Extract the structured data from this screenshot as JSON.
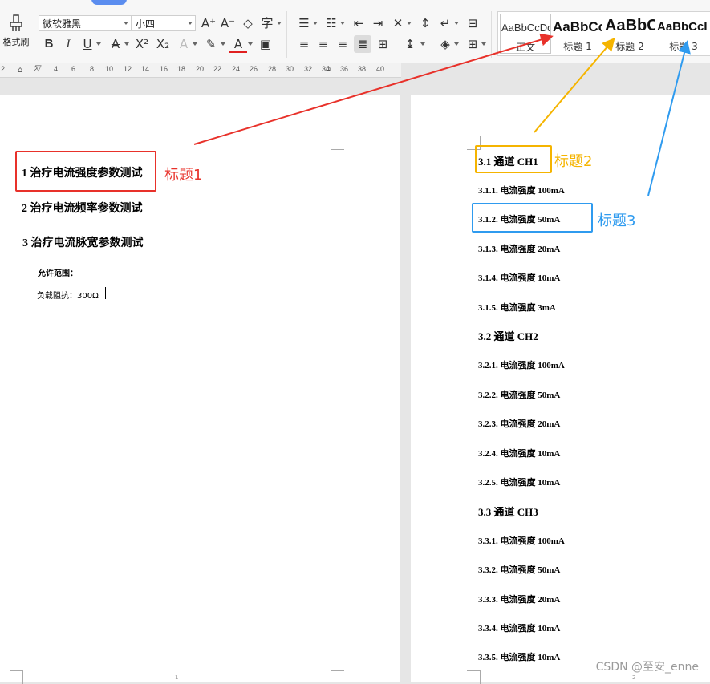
{
  "ribbon": {
    "format_painter_label": "格式刷",
    "font_name": "微软雅黑",
    "font_size": "小四",
    "styles": [
      {
        "sample": "AaBbCcDd",
        "name": "正文"
      },
      {
        "sample": "AaBbCcI",
        "name": "标题 1"
      },
      {
        "sample": "AaBbC",
        "name": "标题 2"
      },
      {
        "sample": "AaBbCcI",
        "name": "标题 3"
      }
    ]
  },
  "ruler": {
    "ticks": [
      "2",
      "2",
      "4",
      "6",
      "8",
      "10",
      "12",
      "14",
      "16",
      "18",
      "20",
      "22",
      "24",
      "26",
      "28",
      "30",
      "32",
      "34",
      "36",
      "38",
      "40"
    ]
  },
  "left_page": {
    "headings": [
      "1 治疗电流强度参数测试",
      "2 治疗电流频率参数测试",
      "3  治疗电流脉宽参数测试"
    ],
    "allowed_range_label": "允许范围：",
    "load_impedance": "负载阻抗：300Ω",
    "page_number": "1"
  },
  "right_page": {
    "lines": [
      "3.1 通道 CH1",
      "3.1.1. 电流强度 100mA",
      "3.1.2. 电流强度 50mA",
      "3.1.3. 电流强度 20mA",
      "3.1.4. 电流强度 10mA",
      "3.1.5. 电流强度 3mA",
      "3.2 通道 CH2",
      "3.2.1.   电流强度 100mA",
      "3.2.2. 电流强度 50mA",
      "3.2.3. 电流强度 20mA",
      "3.2.4. 电流强度 10mA",
      "3.2.5. 电流强度 10mA",
      "3.3 通道 CH3",
      "3.3.1. 电流强度 100mA",
      "3.3.2. 电流强度 50mA",
      "3.3.3. 电流强度 20mA",
      "3.3.4. 电流强度 10mA",
      "3.3.5. 电流强度 10mA"
    ],
    "page_number": "2"
  },
  "annotations": {
    "label_h1": "标题1",
    "label_h2": "标题2",
    "label_h3": "标题3",
    "color_h1": "#e8312a",
    "color_h2": "#f5b400",
    "color_h3": "#2f9bef"
  },
  "watermark": "CSDN @至安_enne"
}
